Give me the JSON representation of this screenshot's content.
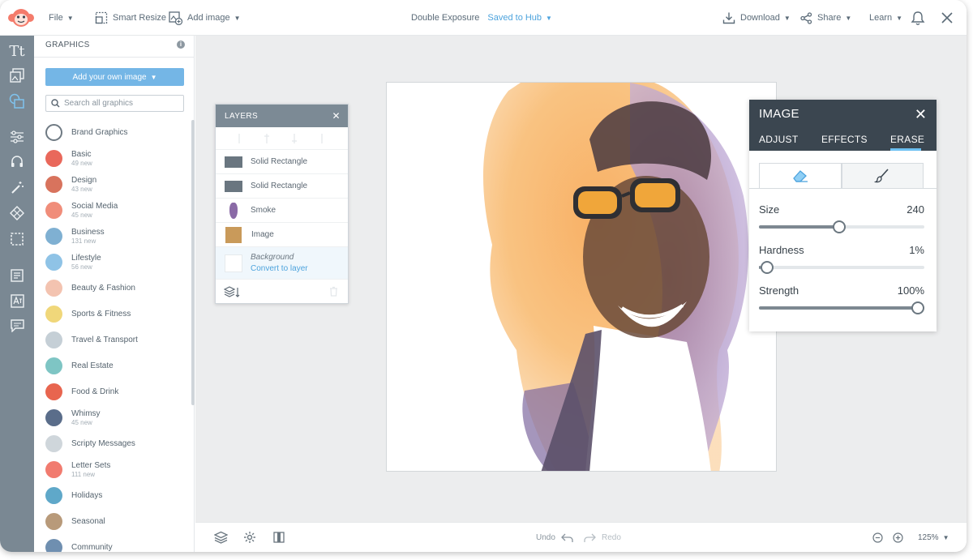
{
  "topbar": {
    "file_label": "File",
    "smart_resize_label": "Smart Resize",
    "add_image_label": "Add image",
    "doc_title": "Double Exposure",
    "save_status": "Saved to Hub",
    "download_label": "Download",
    "share_label": "Share",
    "learn_label": "Learn"
  },
  "rail": {
    "items": [
      "text-icon",
      "image-icon",
      "graphics-icon",
      "adjust-icon",
      "headset-icon",
      "wand-icon",
      "texture-icon",
      "frame-icon",
      "template-icon",
      "translate-icon",
      "comment-icon"
    ],
    "text_label": "Tt"
  },
  "graphics_panel": {
    "title": "GRAPHICS",
    "info_label": "i",
    "add_button_label": "Add your own image",
    "search_placeholder": "Search all graphics",
    "categories": [
      {
        "name": "Brand Graphics",
        "sub": "",
        "color": "#6f7a83"
      },
      {
        "name": "Basic",
        "sub": "49 new",
        "color": "#e9685b"
      },
      {
        "name": "Design",
        "sub": "43 new",
        "color": "#d8735d"
      },
      {
        "name": "Social Media",
        "sub": "45 new",
        "color": "#f08d7a"
      },
      {
        "name": "Business",
        "sub": "131 new",
        "color": "#7fb0d2"
      },
      {
        "name": "Lifestyle",
        "sub": "56 new",
        "color": "#8fc3e6"
      },
      {
        "name": "Beauty & Fashion",
        "sub": "",
        "color": "#f3c3b0"
      },
      {
        "name": "Sports & Fitness",
        "sub": "",
        "color": "#f0d77a"
      },
      {
        "name": "Travel & Transport",
        "sub": "",
        "color": "#c5cfd6"
      },
      {
        "name": "Real Estate",
        "sub": "",
        "color": "#7ec5c4"
      },
      {
        "name": "Food & Drink",
        "sub": "",
        "color": "#e8654f"
      },
      {
        "name": "Whimsy",
        "sub": "45 new",
        "color": "#5a6d8a"
      },
      {
        "name": "Scripty Messages",
        "sub": "",
        "color": "#cfd6db"
      },
      {
        "name": "Letter Sets",
        "sub": "111 new",
        "color": "#f17b6f"
      },
      {
        "name": "Holidays",
        "sub": "",
        "color": "#5fa8c9"
      },
      {
        "name": "Seasonal",
        "sub": "",
        "color": "#b89a7a"
      },
      {
        "name": "Community",
        "sub": "",
        "color": "#6f8fb0"
      }
    ]
  },
  "layers_panel": {
    "title": "LAYERS",
    "rows": [
      {
        "label": "Solid Rectangle",
        "thumb_color": "#6a7680"
      },
      {
        "label": "Solid Rectangle",
        "thumb_color": "#6a7680"
      },
      {
        "label": "Smoke",
        "thumb_color": "#8a6aa6"
      },
      {
        "label": "Image",
        "thumb_color": "#c99a5a"
      }
    ],
    "background_label": "Background",
    "convert_label": "Convert to layer"
  },
  "image_panel": {
    "title": "IMAGE",
    "tabs": [
      "ADJUST",
      "EFFECTS",
      "ERASE"
    ],
    "active_tab": "ERASE",
    "sliders": [
      {
        "label": "Size",
        "value_text": "240",
        "fraction": 0.485
      },
      {
        "label": "Hardness",
        "value_text": "1%",
        "fraction": 0.01
      },
      {
        "label": "Strength",
        "value_text": "100%",
        "fraction": 1.0
      }
    ]
  },
  "bottombar": {
    "undo_label": "Undo",
    "redo_label": "Redo",
    "zoom_label": "125%"
  },
  "colors": {
    "accent": "#4da3dd",
    "rail": "#7a8893",
    "panel_dark": "#3b4650"
  }
}
